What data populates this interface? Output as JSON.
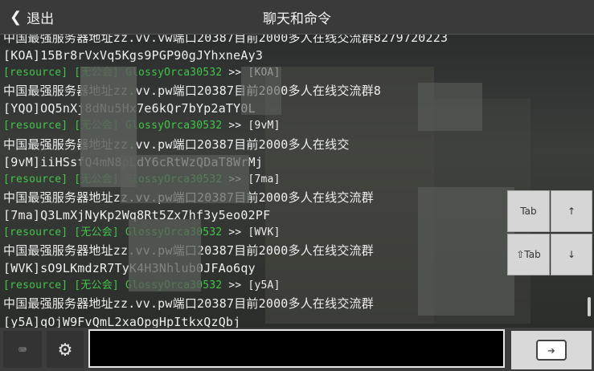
{
  "header": {
    "back_label": "退出",
    "title": "聊天和命令"
  },
  "chat": {
    "lines": [
      {
        "type": "plain",
        "text": "中国最强服务器地址zz.vv.vw端口20387目前2000多人在线交流群8279720223"
      },
      {
        "type": "plain",
        "text": "[KOA]15Br8rVxVq5Kgs9PGP90gJYhxneAy3"
      },
      {
        "type": "meta",
        "tag": "[resource] [无公会] GlossyOrca30532",
        "rest": " >> [KOA]"
      },
      {
        "type": "plain",
        "text": "中国最强服务器地址zz.vv.pw端口20387目前2000多人在线交流群8"
      },
      {
        "type": "plain",
        "text": "[YQO]OQ5nXj8dNu5Hx7e6kQr7bYp2aTY0L"
      },
      {
        "type": "meta",
        "tag": "[resource] [无公会] GlossyOrca30532",
        "rest": " >> [9vM]"
      },
      {
        "type": "plain",
        "text": "中国最强服务器地址zz.vv.pw端口20387目前2000多人在线交"
      },
      {
        "type": "plain",
        "text": "[9vM]iiHSsfQ4mN8pLdY6cRtWzQDaT8WrMj"
      },
      {
        "type": "meta",
        "tag": "[resource] [无公会] GlossyOrca30532",
        "rest": " >> [7ma]"
      },
      {
        "type": "plain",
        "text": "中国最强服务器地址zz.vv.pw端口20387目前2000多人在线交流群"
      },
      {
        "type": "plain",
        "text": "[7ma]Q3LmXjNyKp2Wq8Rt5Zx7hf3y5eo02PF"
      },
      {
        "type": "meta",
        "tag": "[resource] [无公会] GlossyOrca30532",
        "rest": " >> [WVK]"
      },
      {
        "type": "plain",
        "text": "中国最强服务器地址zz.vv.pw端口20387目前2000多人在线交流群"
      },
      {
        "type": "plain",
        "text": "[WVK]sO9LKmdzR7TyK4H3Nhlub0JFAo6qy"
      },
      {
        "type": "meta",
        "tag": "[resource] [无公会] GlossyOrca30532",
        "rest": " >> [y5A]"
      },
      {
        "type": "plain",
        "text": "中国最强服务器地址zz.vv.pw端口20387目前2000多人在线交流群"
      },
      {
        "type": "plain",
        "text": "[y5A]qOjW9FvQmL2xaOpgHpItkxQzQbj"
      }
    ]
  },
  "side_keys": {
    "tab": "Tab",
    "up": "↑",
    "shift_tab": "⇧Tab",
    "down": "↓"
  },
  "input": {
    "value": "",
    "placeholder": ""
  },
  "icons": {
    "keyboard": "keyboard-icon",
    "settings": "gear-icon",
    "send": "send-arrow-icon"
  },
  "colors": {
    "guild_tag": "#43c44a",
    "text": "#eeeeee"
  }
}
